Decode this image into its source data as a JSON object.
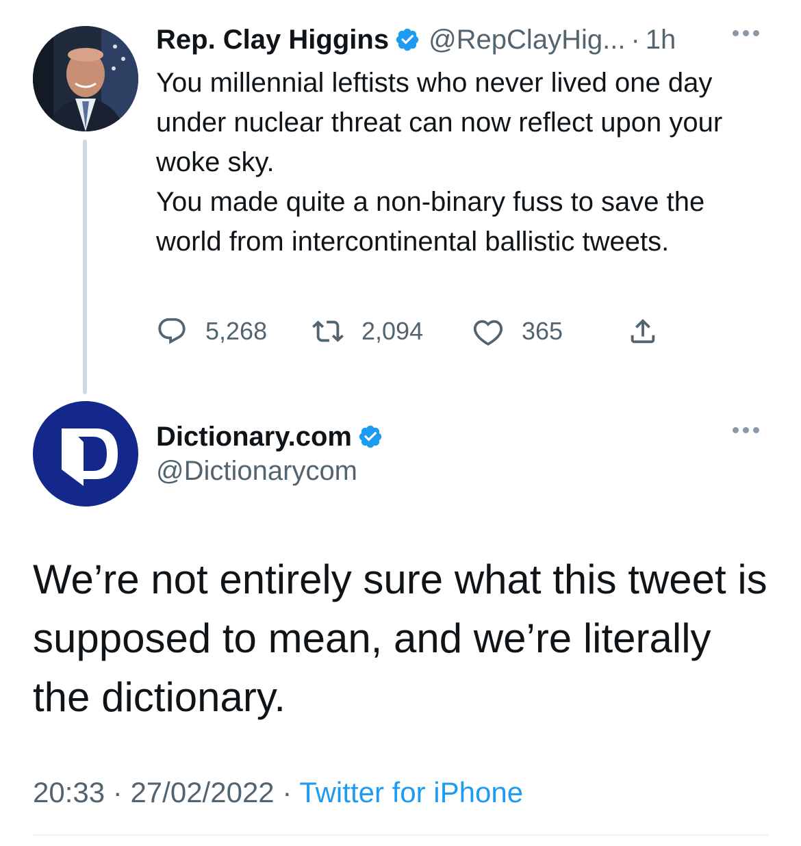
{
  "parent_tweet": {
    "author_name": "Rep. Clay Higgins",
    "author_handle": "@RepClayHig...",
    "separator": "·",
    "time_ago": "1h",
    "text": "You millennial leftists who never lived one day under nuclear threat can now reflect upon your woke sky.\n  You made quite a non-binary fuss to save the world from intercontinental ballistic tweets.",
    "replies": "5,268",
    "retweets": "2,094",
    "likes": "365"
  },
  "main_tweet": {
    "author_name": "Dictionary.com",
    "author_handle": "@Dictionarycom",
    "text": "We’re not entirely sure what this tweet is supposed to mean, and we’re literally the dictionary.",
    "time": "20:33",
    "date": "27/02/2022",
    "separator": "·",
    "source": "Twitter for iPhone"
  },
  "colors": {
    "verified_blue": "#1d9bf0",
    "secondary_text": "#536471",
    "link_blue": "#1d9bf0",
    "dictionary_brand": "#13288a"
  }
}
